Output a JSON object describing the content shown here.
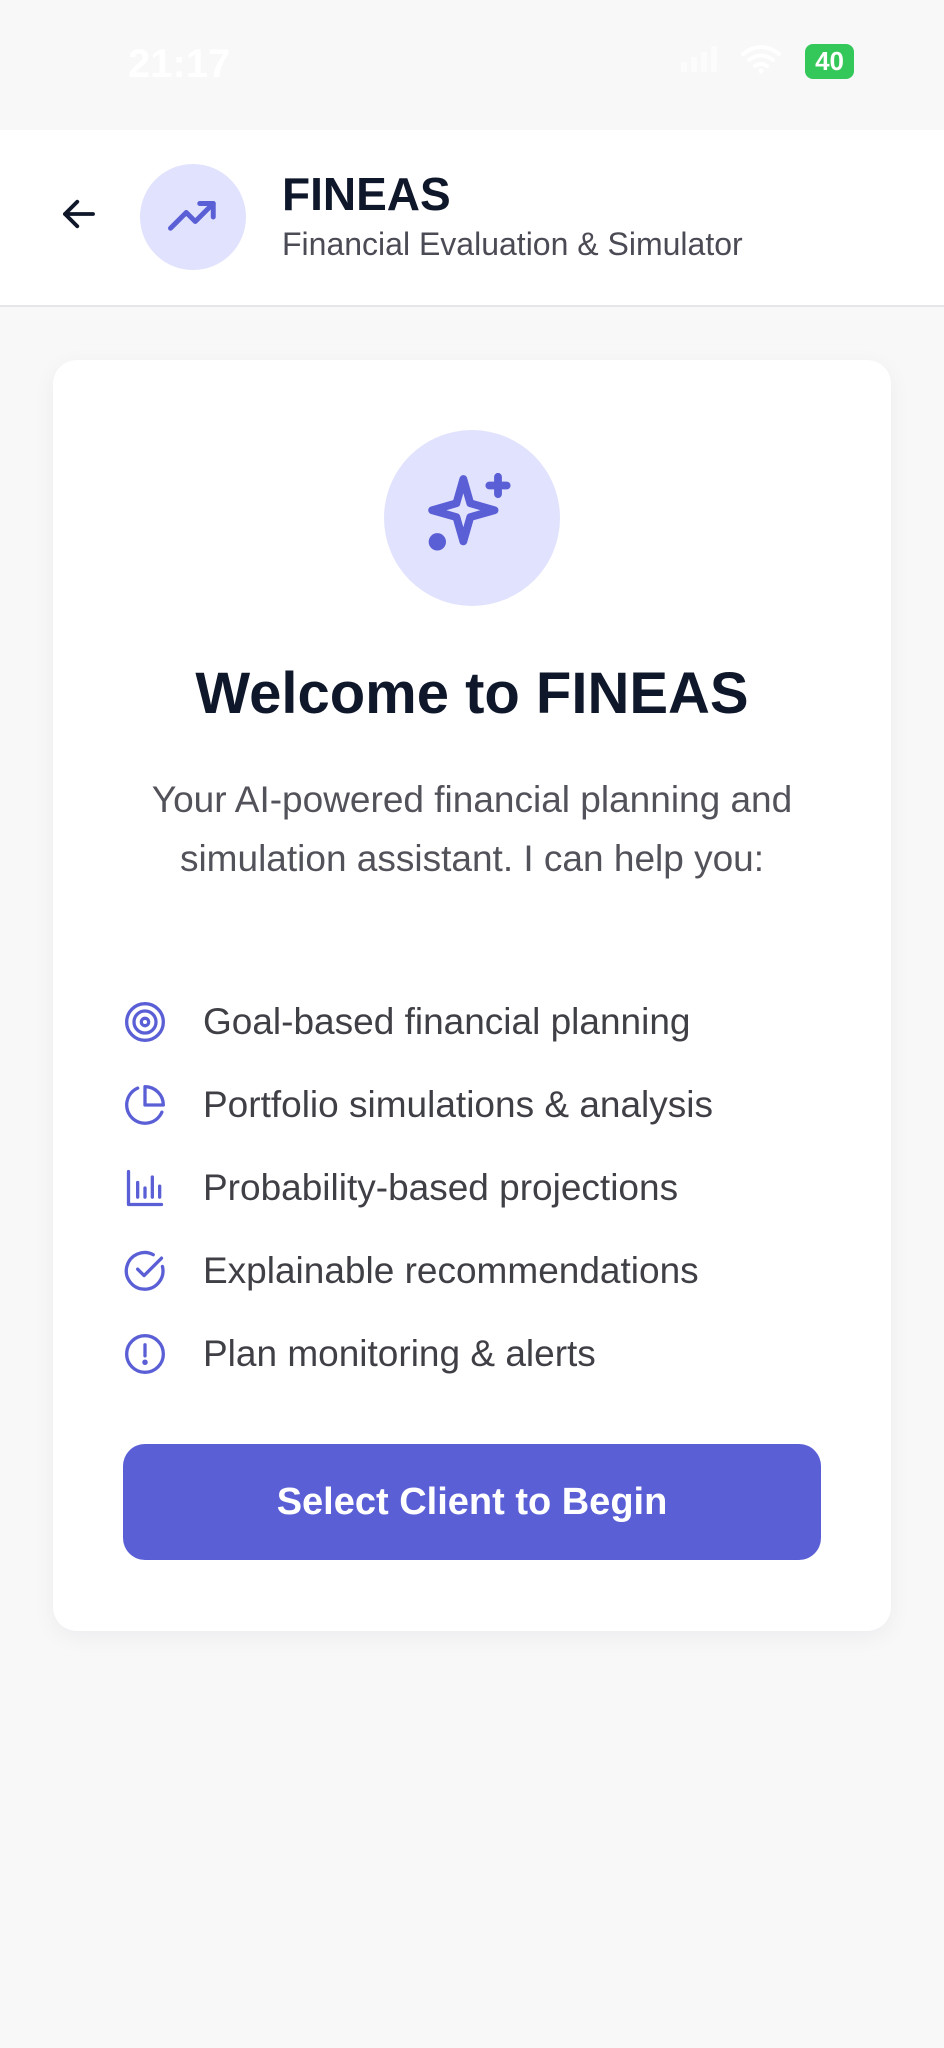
{
  "status_bar": {
    "time": "21:17",
    "battery": "40",
    "icons": [
      "signal-icon",
      "wifi-icon",
      "battery-icon"
    ]
  },
  "header": {
    "back_icon": "arrow-left-icon",
    "logo_icon": "trending-up-icon",
    "title": "FINEAS",
    "subtitle": "Financial Evaluation & Simulator"
  },
  "welcome": {
    "hero_icon": "sparkles-icon",
    "title": "Welcome to FINEAS",
    "intro": "Your AI-powered financial planning and simulation assistant. I can help you:",
    "features": [
      {
        "icon": "target-icon",
        "label": "Goal-based financial planning"
      },
      {
        "icon": "pie-chart-icon",
        "label": "Portfolio simulations & analysis"
      },
      {
        "icon": "bar-chart-icon",
        "label": "Probability-based projections"
      },
      {
        "icon": "check-circle-icon",
        "label": "Explainable recommendations"
      },
      {
        "icon": "alert-circle-icon",
        "label": "Plan monitoring & alerts"
      }
    ],
    "cta_label": "Select Client to Begin"
  },
  "colors": {
    "accent": "#5b5fd6",
    "accent_light": "#e1e2fd",
    "title_text": "#0f172a",
    "body_text": "#52525b",
    "background": "#f8f8f9",
    "battery_green": "#34c759"
  }
}
